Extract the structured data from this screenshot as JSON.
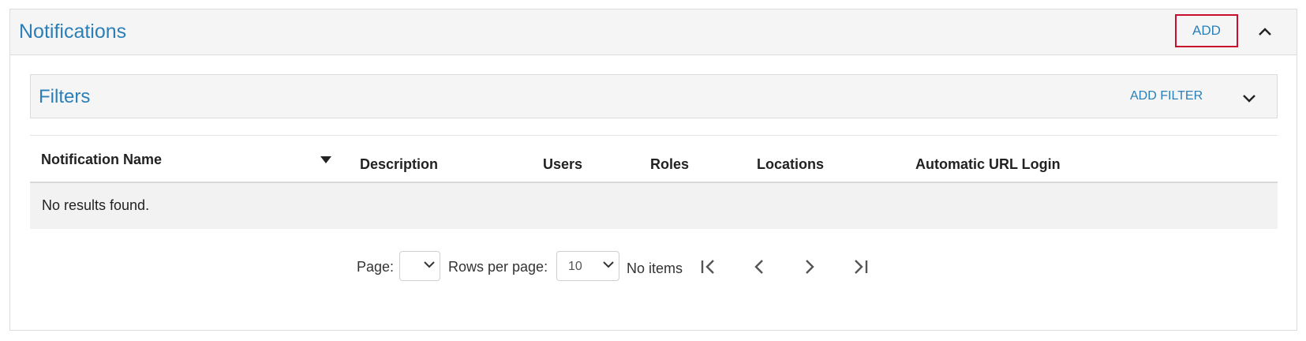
{
  "panel": {
    "title": "Notifications",
    "add_label": "ADD",
    "collapse_icon": "chevron-up-icon"
  },
  "filters": {
    "title": "Filters",
    "add_filter_label": "ADD FILTER",
    "expand_icon": "chevron-down-icon"
  },
  "table": {
    "columns": [
      "Notification Name",
      "Description",
      "Users",
      "Roles",
      "Locations",
      "Automatic URL Login"
    ],
    "sort_icon": "sort-down-icon",
    "empty_message": "No results found."
  },
  "pagination": {
    "page_label": "Page:",
    "page_value": "",
    "rows_label": "Rows per page:",
    "rows_value": "10",
    "status": "No items",
    "icons": [
      "first-page-icon",
      "previous-page-icon",
      "next-page-icon",
      "last-page-icon"
    ]
  },
  "colors": {
    "accent": "#2b7fb8",
    "highlight_border": "#c8102e",
    "header_bg": "#f5f5f5",
    "empty_row_bg": "#f2f2f2"
  }
}
